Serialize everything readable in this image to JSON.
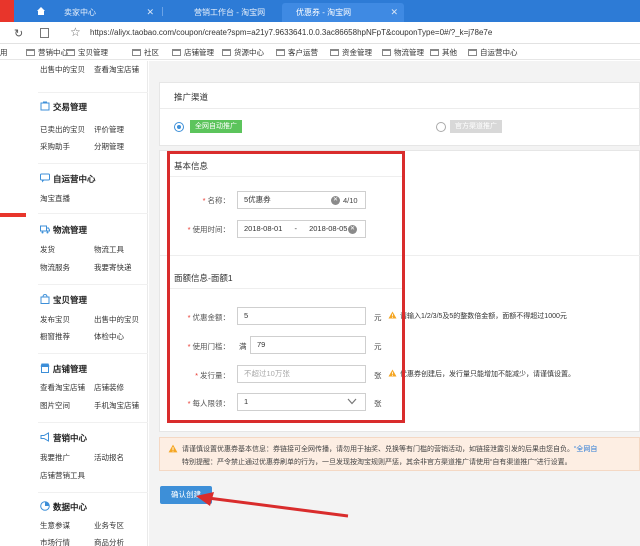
{
  "browser": {
    "tabs": [
      {
        "label": "卖家中心"
      },
      {
        "label": "营销工作台 - 淘宝网"
      },
      {
        "label": "优惠券 - 淘宝网",
        "active": true
      }
    ],
    "url": "https://aliyx.taobao.com/coupon/create?spm=a21y7.9633641.0.0.3ac86658hpNFpT&couponType=0#/?_k=j78e7e",
    "bookmarks": [
      "营销中心",
      "宝贝管理",
      "社区",
      "店铺管理",
      "货源中心",
      "客户运营",
      "资金管理",
      "物流管理",
      "其他",
      "自运营中心"
    ],
    "bookmark_prefix": "用"
  },
  "sidebar": {
    "top_links": [
      "出售中的宝贝",
      "查看淘宝店铺"
    ],
    "sections": [
      {
        "title": "交易管理",
        "links": [
          "已卖出的宝贝",
          "评价管理",
          "采购助手",
          "分期管理"
        ]
      },
      {
        "title": "自运营中心",
        "links": [
          "淘宝直播"
        ]
      },
      {
        "title": "物流管理",
        "links": [
          "发货",
          "物流工具",
          "物流服务",
          "我要寄快递"
        ]
      },
      {
        "title": "宝贝管理",
        "links": [
          "发布宝贝",
          "出售中的宝贝",
          "橱窗推荐",
          "体检中心"
        ]
      },
      {
        "title": "店铺管理",
        "links": [
          "查看淘宝店铺",
          "店铺装修",
          "图片空间",
          "手机淘宝店铺"
        ]
      },
      {
        "title": "营销中心",
        "links": [
          "我要推广",
          "活动报名",
          "店铺营销工具"
        ]
      },
      {
        "title": "数据中心",
        "links": [
          "生意参谋",
          "业务专区",
          "市场行情",
          "商品分析"
        ]
      }
    ]
  },
  "channel": {
    "title": "推广渠道",
    "option1": "全网自动推广",
    "option2": "官方渠道推广"
  },
  "basic": {
    "title": "基本信息",
    "name_label": "名称：",
    "name_value": "5优惠券",
    "name_count": "4/10",
    "time_label": "使用时间：",
    "start_date": "2018-08-01",
    "date_sep": "-",
    "end_date": "2018-08-05"
  },
  "face": {
    "title": "面额信息-面额1",
    "amount_label": "优惠金额：",
    "amount_value": "5",
    "amount_unit": "元",
    "amount_hint": "请输入1/2/3/5及5的整数倍金额，面额不得超过1000元",
    "threshold_label": "使用门槛：",
    "threshold_prefix": "满",
    "threshold_value": "79",
    "threshold_unit": "元",
    "issue_label": "发行量：",
    "issue_placeholder": "不超过10万张",
    "issue_unit": "张",
    "issue_hint": "优惠券创建后，发行量只能增加不能减少，请谨慎设置。",
    "limit_label": "每人限领：",
    "limit_value": "1",
    "limit_unit": "张"
  },
  "notice": {
    "line1": "请谨慎设置优惠券基本信息：券链接可全网传播，请勿用于抽奖、兑换等有门槛的营销活动，如链接泄露引发的后果由您自负。",
    "line1_link": "“全网自",
    "line2": "特别提醒：严令禁止通过优惠券刷单的行为，一旦发现按淘宝规则严惩，其余非官方渠道推广请使用“自有渠道推广”进行设置。"
  },
  "confirm_label": "确认创建",
  "colors": {
    "tabbar": "#2d7bd6",
    "accent": "#3d8fd8",
    "tag_green": "#5cc45c",
    "tag_gray": "#d8d8d8",
    "highlight_red": "#d92c2c",
    "notice_bg": "#fdeee3"
  }
}
